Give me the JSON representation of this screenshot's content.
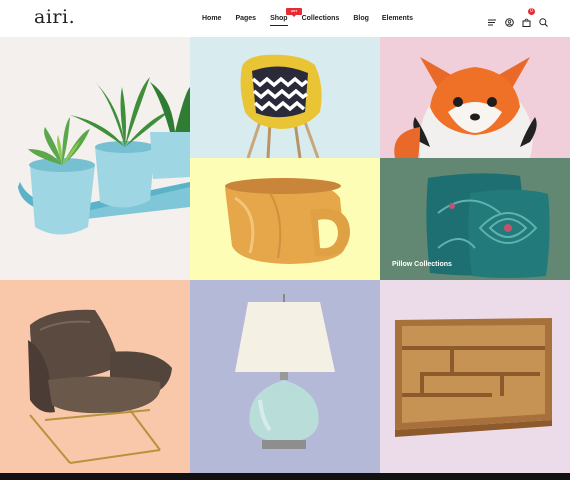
{
  "header": {
    "logo": "airi.",
    "nav": [
      {
        "label": "Home"
      },
      {
        "label": "Pages"
      },
      {
        "label": "Shop"
      },
      {
        "label": "Collections"
      },
      {
        "label": "Blog"
      },
      {
        "label": "Elements"
      }
    ],
    "hot_badge": "HOT",
    "icons": [
      "menu-icon",
      "user-icon",
      "cart-icon",
      "search-icon"
    ],
    "cart_count": "0"
  },
  "tiles": [
    {
      "name": "plants"
    },
    {
      "name": "chair"
    },
    {
      "name": "fox-plush"
    },
    {
      "name": "wooden-cup"
    },
    {
      "name": "pillow",
      "label": "Pillow Collections"
    },
    {
      "name": "armchair"
    },
    {
      "name": "lamp"
    },
    {
      "name": "shelf"
    }
  ],
  "colors": {
    "accent": "#e52b33",
    "tile_plants": "#f3f0ed",
    "tile_chair": "#d8ecf0",
    "tile_fox": "#f0cfda",
    "tile_cup": "#fdfdb5",
    "tile_pillow": "#628874",
    "tile_armchair": "#f9c8aa",
    "tile_lamp": "#b5b9d8",
    "tile_shelf": "#ecdcea"
  }
}
